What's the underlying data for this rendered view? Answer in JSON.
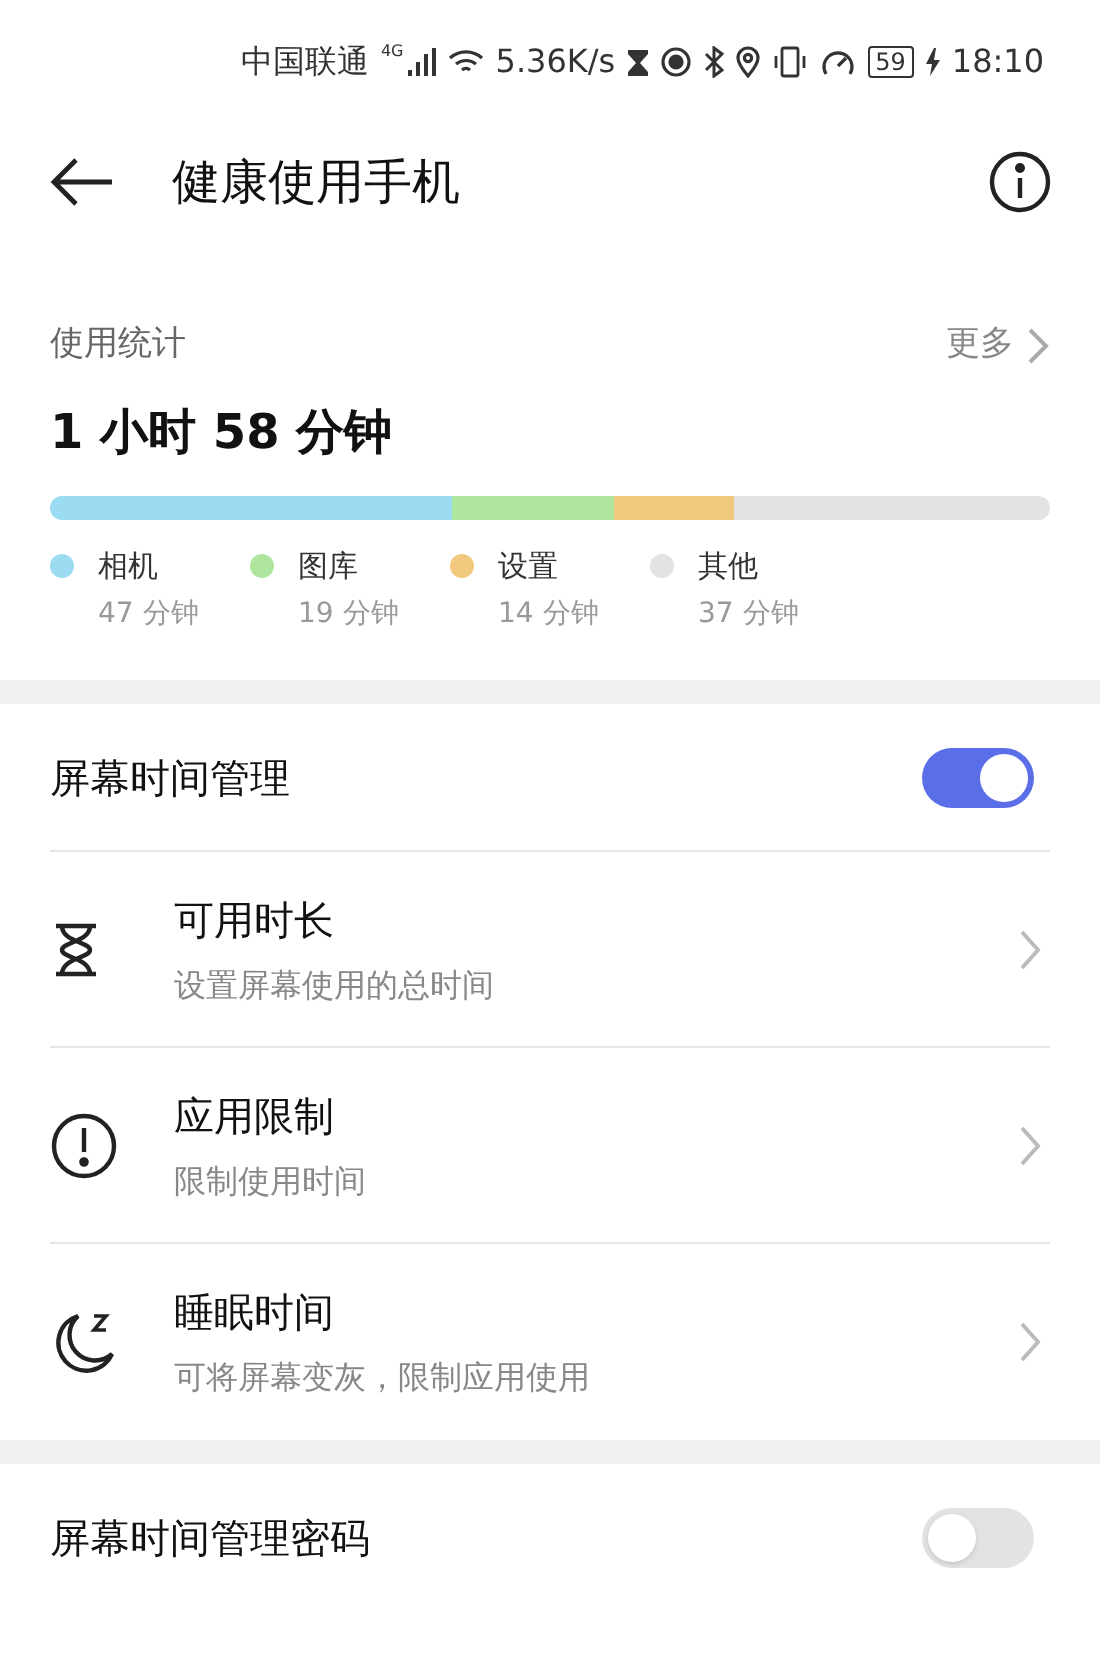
{
  "status_bar": {
    "carrier": "中国联通",
    "network": "4G",
    "speed": "5.36K/s",
    "battery": "59",
    "time": "18:10"
  },
  "header": {
    "title": "健康使用手机"
  },
  "usage": {
    "title": "使用统计",
    "more": "更多",
    "total": "1 小时 58 分钟",
    "categories": [
      {
        "name": "相机",
        "time": "47 分钟",
        "color": "#9cdcf2"
      },
      {
        "name": "图库",
        "time": "19 分钟",
        "color": "#aee6a0"
      },
      {
        "name": "设置",
        "time": "14 分钟",
        "color": "#f0c97e"
      },
      {
        "name": "其他",
        "time": "37 分钟",
        "color": "#e3e3e3"
      }
    ]
  },
  "screen_time": {
    "label": "屏幕时间管理",
    "on": true,
    "items": [
      {
        "kind": "hourglass",
        "title": "可用时长",
        "subtitle": "设置屏幕使用的总时间"
      },
      {
        "kind": "alert",
        "title": "应用限制",
        "subtitle": "限制使用时间"
      },
      {
        "kind": "moon",
        "title": "睡眠时间",
        "subtitle": "可将屏幕变灰，限制应用使用"
      }
    ]
  },
  "password": {
    "label": "屏幕时间管理密码",
    "on": false
  }
}
